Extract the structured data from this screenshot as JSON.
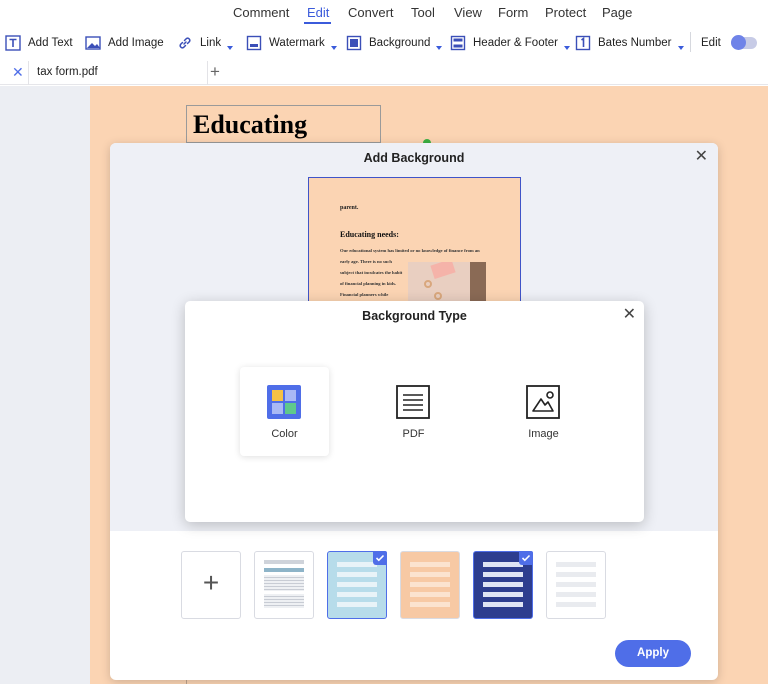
{
  "menu": {
    "items": [
      {
        "label": "Comment"
      },
      {
        "label": "Edit",
        "active": true
      },
      {
        "label": "Convert"
      },
      {
        "label": "Tool"
      },
      {
        "label": "View"
      },
      {
        "label": "Form"
      },
      {
        "label": "Protect"
      },
      {
        "label": "Page"
      }
    ]
  },
  "toolbar": {
    "add_text": "Add Text",
    "add_image": "Add Image",
    "link": "Link",
    "watermark": "Watermark",
    "background": "Background",
    "header_footer": "Header & Footer",
    "bates_number": "Bates Number",
    "edit": "Edit",
    "edit_toggle_on": true
  },
  "tabs": [
    {
      "label": "tax form.pdf"
    }
  ],
  "document": {
    "heading": "Educating needs:"
  },
  "add_background_dialog": {
    "title": "Add Background",
    "preview": {
      "small_text": "parent.",
      "heading": "Educating needs:",
      "lines": [
        "Our educational system has limited or no knowledge of finance from an",
        "early age. There is no such",
        "subject that inculcates the habit",
        "of financial planning in kids.",
        "Financial    planners    while"
      ]
    },
    "apply_label": "Apply",
    "thumbnails": [
      {
        "kind": "add",
        "symbol": "+",
        "selected": false
      },
      {
        "kind": "form",
        "selected": false
      },
      {
        "kind": "light-blue",
        "selected": true
      },
      {
        "kind": "peach",
        "selected": false
      },
      {
        "kind": "navy",
        "selected": true
      },
      {
        "kind": "white",
        "selected": false
      }
    ]
  },
  "background_type_dialog": {
    "title": "Background Type",
    "options": [
      {
        "label": "Color",
        "icon": "color-palette-icon",
        "selected": true
      },
      {
        "label": "PDF",
        "icon": "pdf-document-icon",
        "selected": false
      },
      {
        "label": "Image",
        "icon": "image-icon",
        "selected": false
      }
    ]
  },
  "colors": {
    "accent": "#4f6ee8",
    "document_background": "#fbd4b3",
    "dialog_upper": "#eef0f6"
  }
}
